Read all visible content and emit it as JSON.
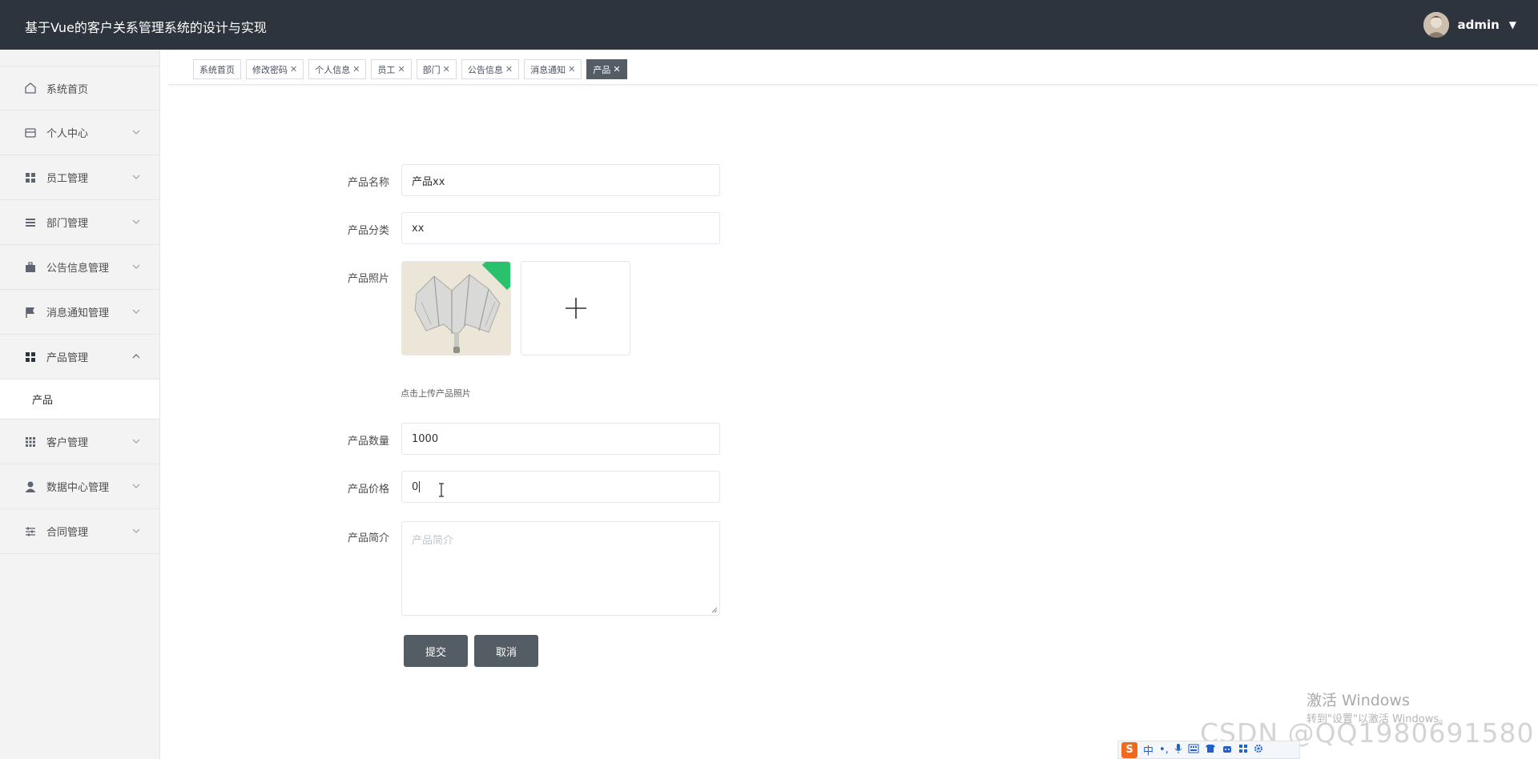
{
  "header": {
    "title": "基于Vue的客户关系管理系统的设计与实现",
    "username": "admin",
    "caret": "▼",
    "bg_color": "#2d343d"
  },
  "sidebar": {
    "items": [
      {
        "label": "系统首页",
        "icon": "home-icon"
      },
      {
        "label": "个人中心",
        "icon": "wallet-icon"
      },
      {
        "label": "员工管理",
        "icon": "grid-icon"
      },
      {
        "label": "部门管理",
        "icon": "list-icon"
      },
      {
        "label": "公告信息管理",
        "icon": "briefcase-icon"
      },
      {
        "label": "消息通知管理",
        "icon": "flag-icon"
      },
      {
        "label": "产品管理",
        "icon": "grid-icon",
        "expanded": true
      },
      {
        "label": "客户管理",
        "icon": "apps-icon"
      },
      {
        "label": "数据中心管理",
        "icon": "user-icon"
      },
      {
        "label": "合同管理",
        "icon": "sliders-icon"
      }
    ],
    "submenu": {
      "label": "产品"
    }
  },
  "tabs": [
    {
      "label": "系统首页",
      "closable": false
    },
    {
      "label": "修改密码",
      "closable": true
    },
    {
      "label": "个人信息",
      "closable": true
    },
    {
      "label": "员工",
      "closable": true
    },
    {
      "label": "部门",
      "closable": true
    },
    {
      "label": "公告信息",
      "closable": true
    },
    {
      "label": "消息通知",
      "closable": true
    },
    {
      "label": "产品",
      "closable": true,
      "active": true
    }
  ],
  "tab_close_glyph": "✕",
  "form": {
    "name_label": "产品名称",
    "name_value": "产品xx",
    "category_label": "产品分类",
    "category_value": "xx",
    "photo_label": "产品照片",
    "photo_hint": "点击上传产品照片",
    "quantity_label": "产品数量",
    "quantity_value": "1000",
    "price_label": "产品价格",
    "price_value": "0",
    "intro_label": "产品简介",
    "intro_placeholder": "产品简介",
    "submit_label": "提交",
    "cancel_label": "取消"
  },
  "overlay": {
    "activate_title": "激活 Windows",
    "activate_sub": "转到\"设置\"以激活 Windows。",
    "watermark": "CSDN @QQ1980691580",
    "ime_logo": "S",
    "ime_lang": "中"
  },
  "colors": {
    "button": "#545c64",
    "active_tab": "#545c64",
    "sidebar_bg": "#f3f3f3",
    "badge_green": "#29c16b"
  }
}
